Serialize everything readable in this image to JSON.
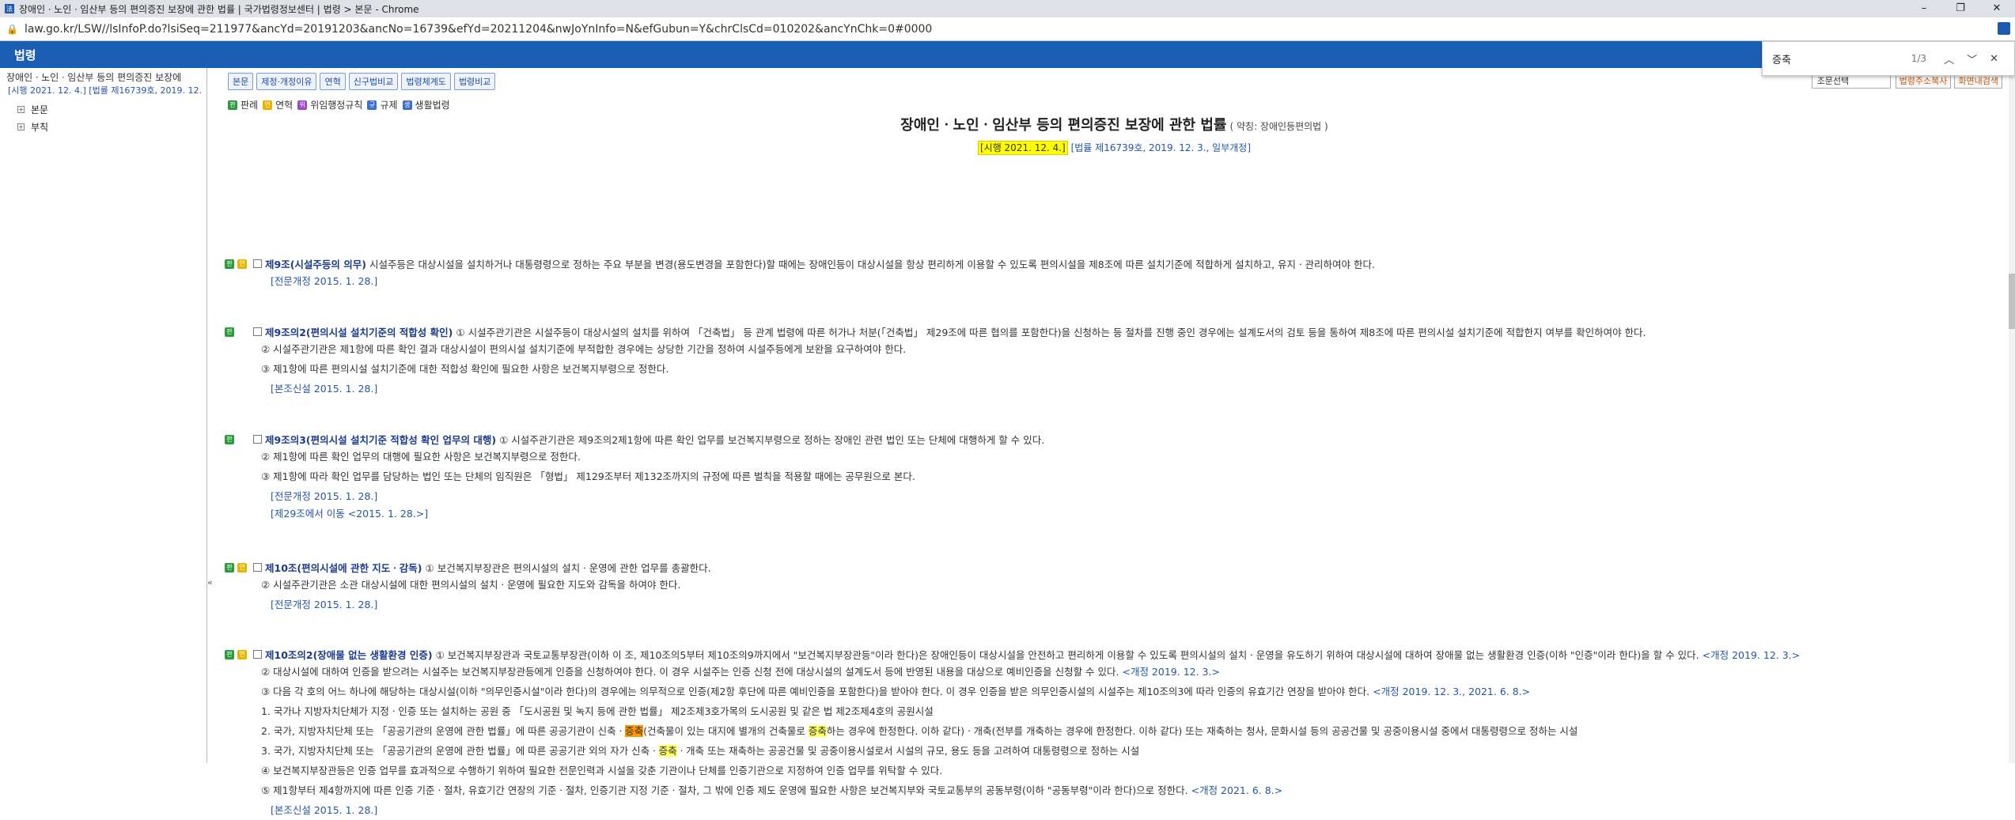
{
  "browser": {
    "window_title": "장애인ㆍ노인ㆍ임산부 등의 편의증진 보장에 관한 법률 | 국가법령정보센터 | 법령 > 본문 - Chrome",
    "url": "law.go.kr/LSW//lsInfoP.do?lsiSeq=211977&ancYd=20191203&ancNo=16739&efYd=20211204&nwJoYnInfo=N&efGubun=Y&chrClsCd=010202&ancYnChk=0#0000",
    "min": "–",
    "max": "❐",
    "close": "✕"
  },
  "header": {
    "title": "법령"
  },
  "find": {
    "query": "증축",
    "count": "1/3",
    "prev": "︿",
    "next": "﹀",
    "close": "✕"
  },
  "left": {
    "doc_title": "장애인ㆍ노인ㆍ임산부 등의 편의증진 보장에",
    "doc_sub": "[시행 2021. 12. 4.] [법률 제16739호, 2019. 12.",
    "tree": [
      "본문",
      "부칙"
    ],
    "collapse": "«"
  },
  "tabs": [
    "본문",
    "제정·개정이유",
    "연혁",
    "신구법비교",
    "법령체계도",
    "법령비교"
  ],
  "tools": {
    "select": "조문선택",
    "btn1": "법령주소복사",
    "btn2": "화면내검색"
  },
  "legend": [
    {
      "icon": "판",
      "label": "판례",
      "color": "#2a9a3a"
    },
    {
      "icon": "연",
      "label": "연혁",
      "color": "#e7b400"
    },
    {
      "icon": "위",
      "label": "위임행정규칙",
      "color": "#9c4ac9"
    },
    {
      "icon": "규",
      "label": "규제",
      "color": "#3d6fd0"
    },
    {
      "icon": "생",
      "label": "생활법령",
      "color": "#3d6fd0"
    }
  ],
  "law": {
    "title": "장애인ㆍ노인ㆍ임산부 등의 편의증진 보장에 관한 법률",
    "abbr": "( 약칭: 장애인등편의법 )",
    "date_hl": "[시행 2021. 12. 4.]",
    "date_rest": "[법률 제16739호, 2019. 12. 3., 일부개정]"
  },
  "articles": {
    "a9": {
      "title": "제9조(시설주등의 의무)",
      "body": "시설주등은 대상시설을 설치하거나 대통령령으로 정하는 주요 부분을 변경(용도변경을 포함한다)할 때에는 장애인등이 대상시설을 항상 편리하게 이용할 수 있도록 편의시설을 제8조에 따른 설치기준에 적합하게 설치하고, 유지ㆍ관리하여야 한다.",
      "note": "[전문개정 2015. 1. 28.]"
    },
    "a9_2": {
      "title": "제9조의2(편의시설 설치기준의 적합성 확인)",
      "p1": "① 시설주관기관은 시설주등이 대상시설의 설치를 위하여 「건축법」 등 관계 법령에 따른 허가나 처분(「건축법」 제29조에 따른 협의를 포함한다)을 신청하는 등 절차를 진행 중인 경우에는 설계도서의 검토 등을 통하여 제8조에 따른 편의시설 설치기준에 적합한지 여부를 확인하여야 한다.",
      "p2": "② 시설주관기관은 제1항에 따른 확인 결과 대상시설이 편의시설 설치기준에 부적합한 경우에는 상당한 기간을 정하여 시설주등에게 보완을 요구하여야 한다.",
      "p3": "③ 제1항에 따른 편의시설 설치기준에 대한 적합성 확인에 필요한 사항은 보건복지부령으로 정한다.",
      "note": "[본조신설 2015. 1. 28.]"
    },
    "a9_3": {
      "title": "제9조의3(편의시설 설치기준 적합성 확인 업무의 대행)",
      "p1": "① 시설주관기관은 제9조의2제1항에 따른 확인 업무를 보건복지부령으로 정하는 장애인 관련 법인 또는 단체에 대행하게 할 수 있다.",
      "p2": "② 제1항에 따른 확인 업무의 대행에 필요한 사항은 보건복지부령으로 정한다.",
      "p3": "③ 제1항에 따라 확인 업무를 담당하는 법인 또는 단체의 임직원은 「형법」 제129조부터 제132조까지의 규정에 따른 벌칙을 적용할 때에는 공무원으로 본다.",
      "note": "[전문개정 2015. 1. 28.]",
      "note2": "[제29조에서 이동 <2015. 1. 28.>]"
    },
    "a10": {
      "title": "제10조(편의시설에 관한 지도ㆍ감독)",
      "p1": "① 보건복지부장관은 편의시설의 설치ㆍ운영에 관한 업무를 총괄한다.",
      "p2": "② 시설주관기관은 소관 대상시설에 대한 편의시설의 설치ㆍ운영에 필요한 지도와 감독을 하여야 한다.",
      "note": "[전문개정 2015. 1. 28.]"
    },
    "a10_2": {
      "title": "제10조의2(장애물 없는 생활환경 인증)",
      "p1": "① 보건복지부장관과 국토교통부장관(이하 이 조, 제10조의5부터 제10조의9까지에서 \"보건복지부장관등\"이라 한다)은 장애인등이 대상시설을 안전하고 편리하게 이용할 수 있도록 편의시설의 설치ㆍ운영을 유도하기 위하여 대상시설에 대하여 장애물 없는 생활환경 인증(이하 \"인증\"이라 한다)을 할 수 있다.",
      "p1_amend": "<개정 2019. 12. 3.>",
      "p2": "② 대상시설에 대하여 인증을 받으려는 시설주는 보건복지부장관등에게 인증을 신청하여야 한다. 이 경우 시설주는 인증 신청 전에 대상시설의 설계도서 등에 반영된 내용을 대상으로 예비인증을 신청할 수 있다.",
      "p2_amend": "<개정 2019. 12. 3.>",
      "p3": "③ 다음 각 호의 어느 하나에 해당하는 대상시설(이하 \"의무인증시설\"이라 한다)의 경우에는 의무적으로 인증(제2항 후단에 따른 예비인증을 포함한다)을 받아야 한다. 이 경우 인증을 받은 의무인증시설의 시설주는 제10조의3에 따라 인증의 유효기간 연장을 받아야 한다.",
      "p3_amend": "<개정 2019. 12. 3., 2021. 6. 8.>",
      "i1": "1. 국가나 지방자치단체가 지정ㆍ인증 또는 설치하는 공원 중 「도시공원 및 녹지 등에 관한 법률」 제2조제3호가목의 도시공원 및 같은 법 제2조제4호의 공원시설",
      "i2a": "2. 국가, 지방자치단체 또는 「공공기관의 운영에 관한 법률」에 따른 공공기관이 신축ㆍ",
      "i2hl1": "증축",
      "i2b": "(건축물이 있는 대지에 별개의 건축물로 ",
      "i2hl2": "증축",
      "i2c": "하는 경우에 한정한다. 이하 같다)ㆍ개축(전부를 개축하는 경우에 한정한다. 이하 같다) 또는 재축하는 청사, 문화시설 등의 공공건물 및 공중이용시설 중에서 대통령령으로 정하는 시설",
      "i3a": "3. 국가, 지방자치단체 또는 「공공기관의 운영에 관한 법률」에 따른 공공기관 외의 자가 신축ㆍ",
      "i3hl": "증축",
      "i3b": "ㆍ개축 또는 재축하는 공공건물 및 공중이용시설로서 시설의 규모, 용도 등을 고려하여 대통령령으로 정하는 시설",
      "p4": "④ 보건복지부장관등은 인증 업무를 효과적으로 수행하기 위하여 필요한 전문인력과 시설을 갖춘 기관이나 단체를 인증기관으로 지정하여 인증 업무를 위탁할 수 있다.",
      "p5": "⑤ 제1항부터 제4항까지에 따른 인증 기준ㆍ절차, 유효기간 연장의 기준ㆍ절차, 인증기관 지정 기준ㆍ절차, 그 밖에 인증 제도 운영에 필요한 사항은 보건복지부와 국토교통부의 공동부령(이하 \"공동부령\"이라 한다)으로 정한다.",
      "p5_amend": "<개정 2021. 6. 8.>",
      "note": "[본조신설 2015. 1. 28.]"
    }
  }
}
